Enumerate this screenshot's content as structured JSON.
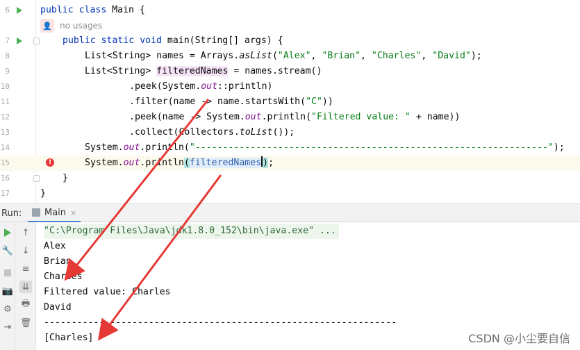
{
  "editor": {
    "usages_hint": "no usages",
    "lines": {
      "l6": {
        "no": "6",
        "kw1": "public",
        "kw2": "class",
        "rest": " Main {"
      },
      "l7": {
        "no": "7",
        "kw1": "public",
        "kw2": "static",
        "kw3": "void",
        "rest": " main(String[] args) {"
      },
      "l8": {
        "no": "8",
        "a": "List<String> names = Arrays.",
        "b": "asList",
        "c": "(",
        "s1": "\"Alex\"",
        "c1": ", ",
        "s2": "\"Brian\"",
        "c2": ", ",
        "s3": "\"Charles\"",
        "c3": ", ",
        "s4": "\"David\"",
        "d": ");"
      },
      "l9": {
        "no": "9",
        "a": "List<String> ",
        "var": "filteredNames",
        "b": " = names.stream()"
      },
      "l10": {
        "no": "10",
        "a": ".peek(System.",
        "f": "out",
        "b": "::println)"
      },
      "l11": {
        "no": "11",
        "a": ".filter(name -> name.startsWith(",
        "s": "\"C\"",
        "b": "))"
      },
      "l12": {
        "no": "12",
        "a": ".peek(name -> System.",
        "f": "out",
        "b": ".println(",
        "s": "\"Filtered value: \"",
        "c": " + name))"
      },
      "l13": {
        "no": "13",
        "a": ".collect(Collectors.",
        "i": "toList",
        "b": "());"
      },
      "l14": {
        "no": "14",
        "a": "System.",
        "f": "out",
        "b": ".println(",
        "s": "\"----------------------------------------------------------------\"",
        "c": ");"
      },
      "l15": {
        "no": "15",
        "a": "System.",
        "f": "out",
        "b": ".println",
        "p1": "(",
        "var": "filteredNames",
        "p2": ")",
        "c": ";"
      },
      "l16": {
        "no": "16",
        "a": "}"
      },
      "l17": {
        "no": "17",
        "a": "}"
      }
    }
  },
  "run": {
    "label": "Run:",
    "tab_label": "Main",
    "tab_close": "×",
    "output": [
      "\"C:\\Program Files\\Java\\jdk1.8.0_152\\bin\\java.exe\" ...",
      "Alex",
      "Brian",
      "Charles",
      "Filtered value: Charles",
      "David",
      "----------------------------------------------------------------",
      "[Charles]"
    ]
  },
  "watermark": "CSDN @小尘要自信",
  "colors": {
    "keyword": "#0033b3",
    "string": "#067d17",
    "field": "#871094",
    "arrow": "#e53935"
  }
}
